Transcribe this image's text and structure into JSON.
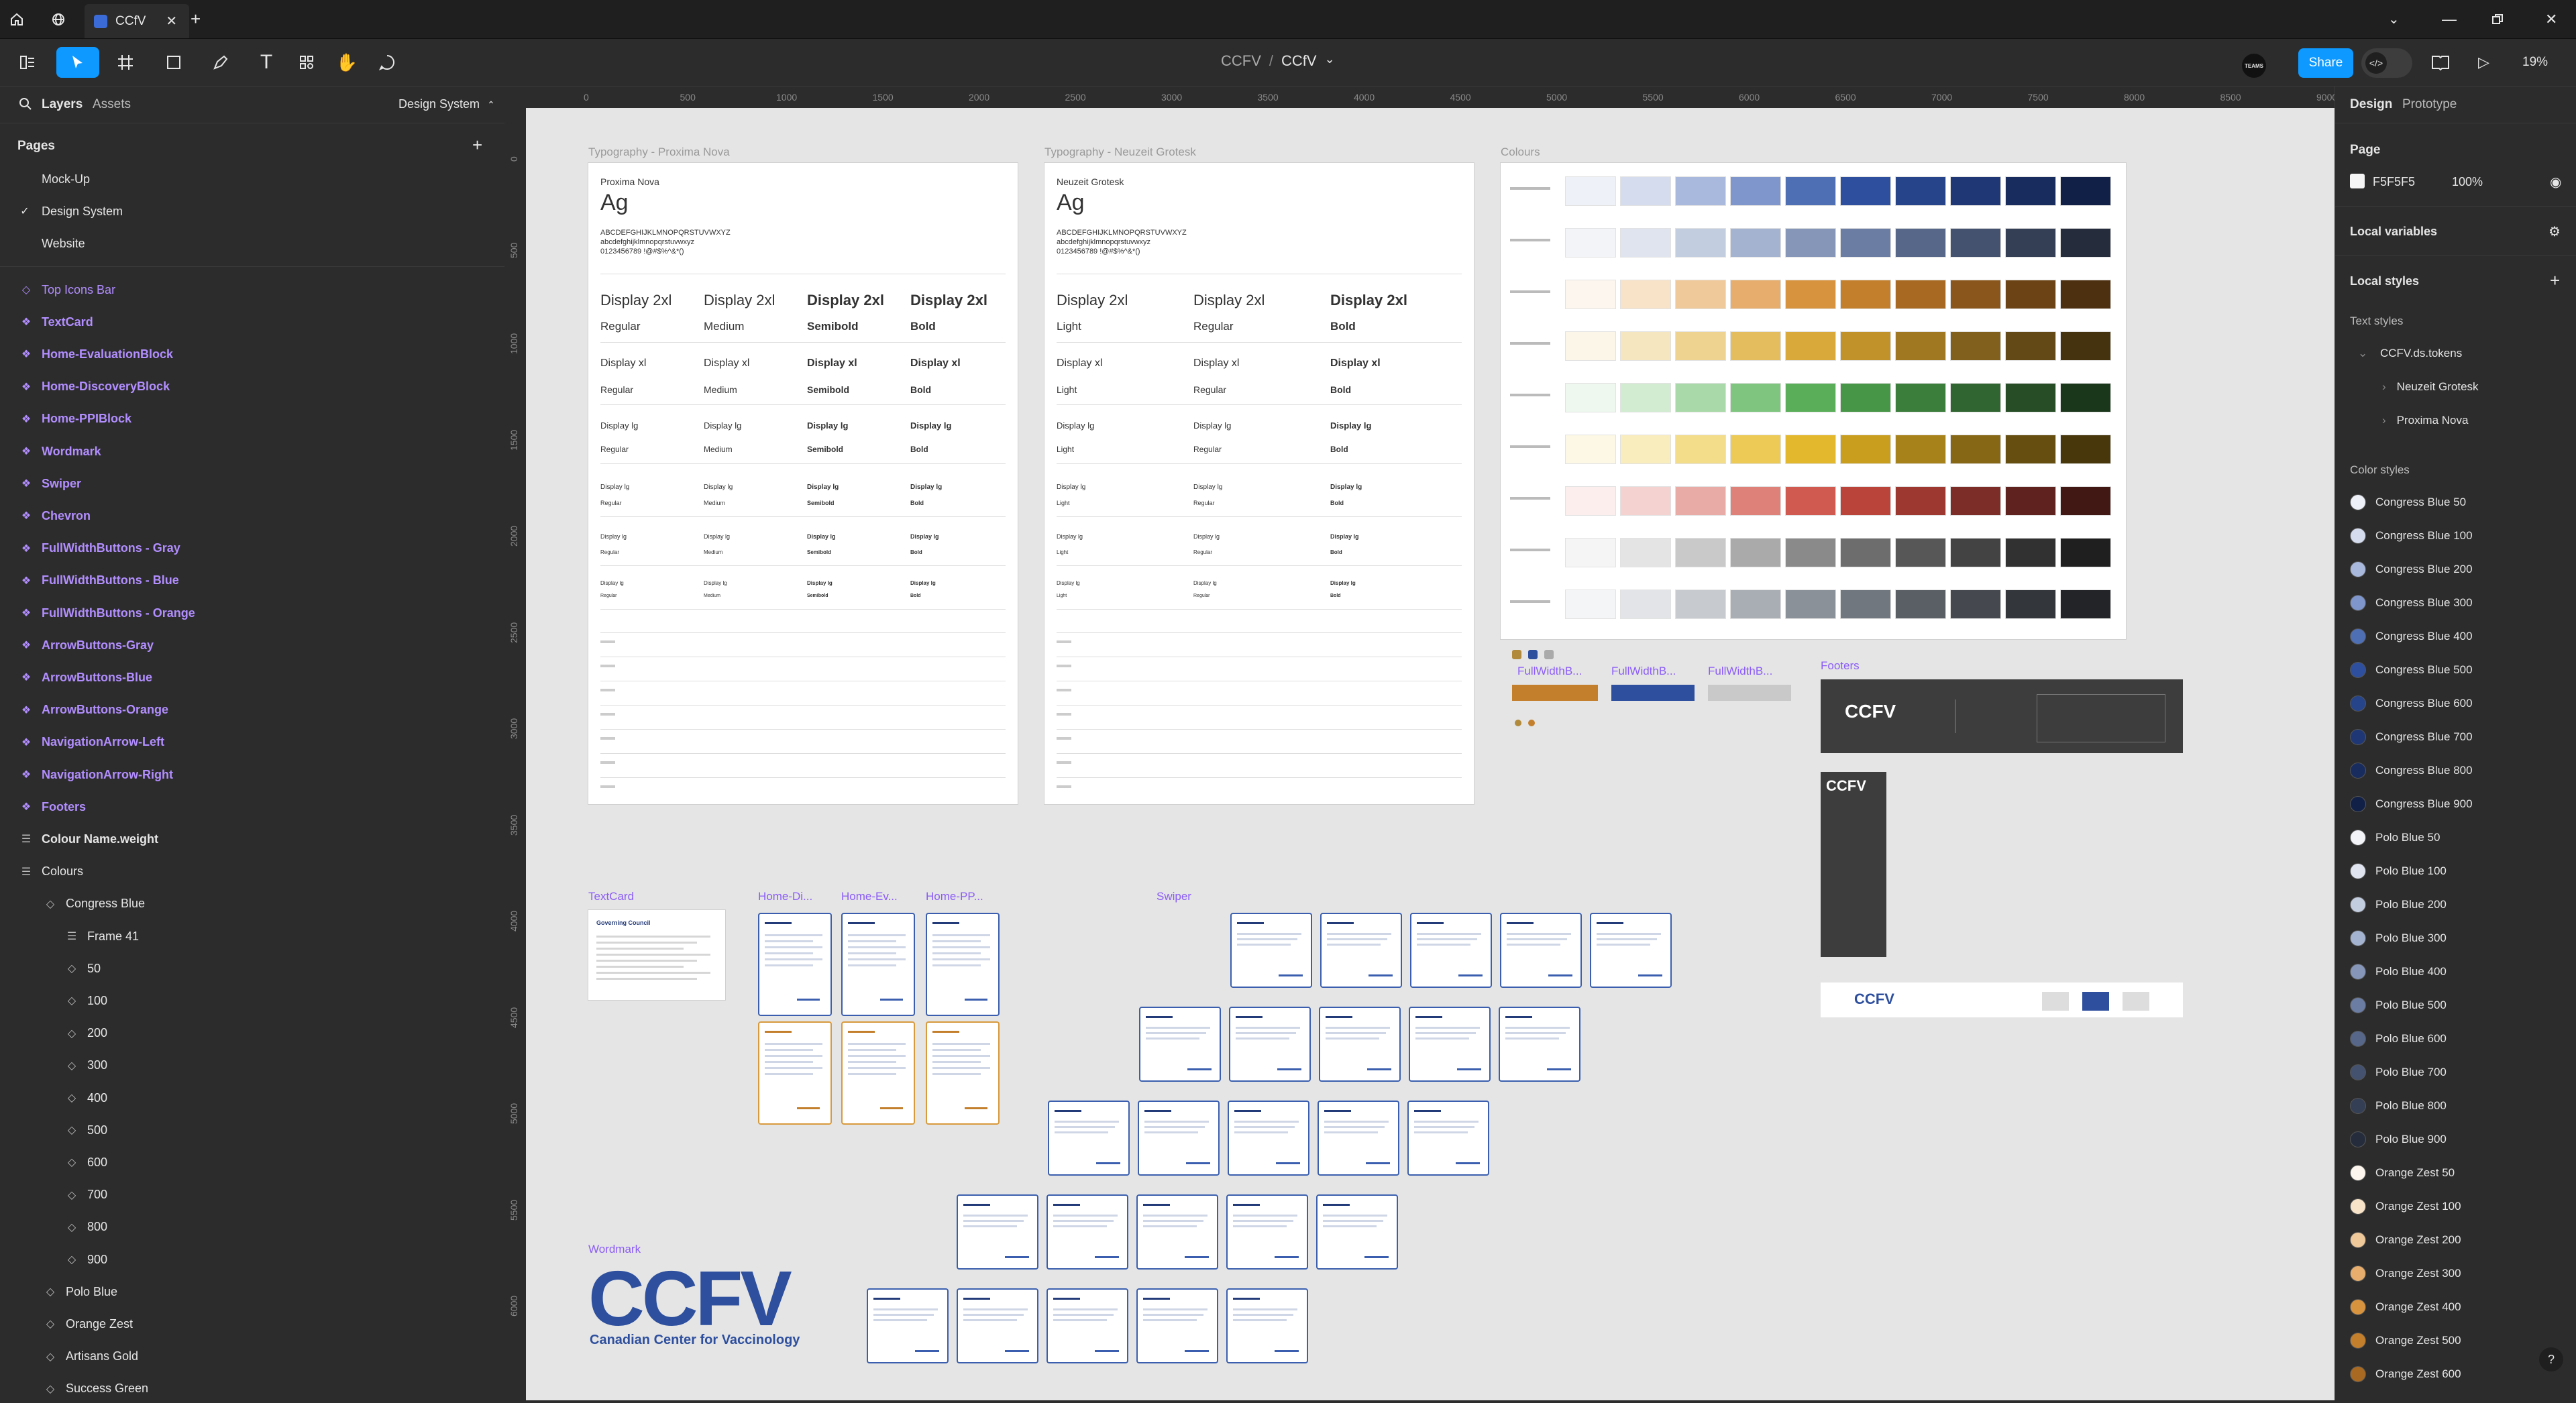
{
  "tabbar": {
    "file_tab_label": "CCfV",
    "new_tab": "+"
  },
  "toolbar": {
    "breadcrumb_project": "CCFV",
    "breadcrumb_sep": "/",
    "breadcrumb_file": "CCfV",
    "teams_badge": "TEAMS",
    "share_label": "Share",
    "zoom_level": "19%"
  },
  "ruler": {
    "top": [
      "0",
      "500",
      "1000",
      "1500",
      "2000",
      "2500",
      "3000",
      "3500",
      "4000",
      "4500",
      "5000",
      "5500",
      "6000",
      "6500",
      "7000",
      "7500",
      "8000",
      "8500",
      "9000"
    ],
    "left": [
      "0",
      "500",
      "1000",
      "1500",
      "2000",
      "2500",
      "3000",
      "3500",
      "4000",
      "4500",
      "5000",
      "5500",
      "6000"
    ]
  },
  "leftpanel": {
    "tab_layers": "Layers",
    "tab_assets": "Assets",
    "page_selector": "Design System",
    "pages_header": "Pages",
    "add_page": "+",
    "pages": [
      "Mock-Up",
      "Design System",
      "Website"
    ],
    "layers": [
      {
        "label": "Top Icons Bar",
        "kind": "frame"
      },
      {
        "label": "TextCard",
        "kind": "comp"
      },
      {
        "label": "Home-EvaluationBlock",
        "kind": "comp"
      },
      {
        "label": "Home-DiscoveryBlock",
        "kind": "comp"
      },
      {
        "label": "Home-PPIBlock",
        "kind": "comp"
      },
      {
        "label": "Wordmark",
        "kind": "comp"
      },
      {
        "label": "Swiper",
        "kind": "comp"
      },
      {
        "label": "Chevron",
        "kind": "comp"
      },
      {
        "label": "FullWidthButtons - Gray",
        "kind": "comp"
      },
      {
        "label": "FullWidthButtons - Blue",
        "kind": "comp"
      },
      {
        "label": "FullWidthButtons - Orange",
        "kind": "comp"
      },
      {
        "label": "ArrowButtons-Gray",
        "kind": "comp"
      },
      {
        "label": "ArrowButtons-Blue",
        "kind": "comp"
      },
      {
        "label": "ArrowButtons-Orange",
        "kind": "comp"
      },
      {
        "label": "NavigationArrow-Left",
        "kind": "comp"
      },
      {
        "label": "NavigationArrow-Right",
        "kind": "comp"
      },
      {
        "label": "Footers",
        "kind": "comp"
      },
      {
        "label": "Colour Name.weight",
        "kind": "plain"
      },
      {
        "label": "Colours",
        "kind": "plain"
      },
      {
        "label": "Congress Blue",
        "kind": "sub"
      },
      {
        "label": "Frame 41",
        "kind": "sub2"
      },
      {
        "label": "50",
        "kind": "sub3"
      },
      {
        "label": "100",
        "kind": "sub3"
      },
      {
        "label": "200",
        "kind": "sub3"
      },
      {
        "label": "300",
        "kind": "sub3"
      },
      {
        "label": "400",
        "kind": "sub3"
      },
      {
        "label": "500",
        "kind": "sub3"
      },
      {
        "label": "600",
        "kind": "sub3"
      },
      {
        "label": "700",
        "kind": "sub3"
      },
      {
        "label": "800",
        "kind": "sub3"
      },
      {
        "label": "900",
        "kind": "sub3"
      },
      {
        "label": "Polo Blue",
        "kind": "sub"
      },
      {
        "label": "Orange Zest",
        "kind": "sub"
      },
      {
        "label": "Artisans Gold",
        "kind": "sub"
      },
      {
        "label": "Success Green",
        "kind": "sub"
      }
    ]
  },
  "rightpanel": {
    "tab_design": "Design",
    "tab_prototype": "Prototype",
    "page_header": "Page",
    "page_color": "F5F5F5",
    "page_opacity": "100%",
    "local_variables": "Local variables",
    "local_styles": "Local styles",
    "text_styles": "Text styles",
    "text_group": "CCFV.ds.tokens",
    "text_items": [
      "Neuzeit Grotesk",
      "Proxima Nova"
    ],
    "color_styles": "Color styles",
    "colors": [
      {
        "name": "Congress Blue 50",
        "hex": "#eef1f8"
      },
      {
        "name": "Congress Blue 100",
        "hex": "#d4dcee"
      },
      {
        "name": "Congress Blue 200",
        "hex": "#a9b9dd"
      },
      {
        "name": "Congress Blue 300",
        "hex": "#7e96cc"
      },
      {
        "name": "Congress Blue 400",
        "hex": "#4f6fb5"
      },
      {
        "name": "Congress Blue 500",
        "hex": "#2d4f9e"
      },
      {
        "name": "Congress Blue 600",
        "hex": "#26448a"
      },
      {
        "name": "Congress Blue 700",
        "hex": "#1f3875"
      },
      {
        "name": "Congress Blue 800",
        "hex": "#182c5e"
      },
      {
        "name": "Congress Blue 900",
        "hex": "#112047"
      },
      {
        "name": "Polo Blue 50",
        "hex": "#f2f4f8"
      },
      {
        "name": "Polo Blue 100",
        "hex": "#dfe4ee"
      },
      {
        "name": "Polo Blue 200",
        "hex": "#c3cde0"
      },
      {
        "name": "Polo Blue 300",
        "hex": "#a4b3cf"
      },
      {
        "name": "Polo Blue 400",
        "hex": "#8596b9"
      },
      {
        "name": "Polo Blue 500",
        "hex": "#6b7da3"
      },
      {
        "name": "Polo Blue 600",
        "hex": "#56678a"
      },
      {
        "name": "Polo Blue 700",
        "hex": "#44526f"
      },
      {
        "name": "Polo Blue 800",
        "hex": "#343f55"
      },
      {
        "name": "Polo Blue 900",
        "hex": "#252d3d"
      },
      {
        "name": "Orange Zest 50",
        "hex": "#fdf6ee"
      },
      {
        "name": "Orange Zest 100",
        "hex": "#f8e3c9"
      },
      {
        "name": "Orange Zest 200",
        "hex": "#f0c99a"
      },
      {
        "name": "Orange Zest 300",
        "hex": "#e6ad6c"
      },
      {
        "name": "Orange Zest 400",
        "hex": "#d8933f"
      },
      {
        "name": "Orange Zest 500",
        "hex": "#c47f2c"
      },
      {
        "name": "Orange Zest 600",
        "hex": "#a86a22"
      }
    ]
  },
  "canvas": {
    "frame_typo_proxima": "Typography - Proxima Nova",
    "frame_typo_neuzeit": "Typography - Neuzeit Grotesk",
    "frame_colours": "Colours",
    "proxima_font": "Proxima Nova",
    "neuzeit_font": "Neuzeit Grotesk",
    "specimen_ag": "Ag",
    "specimen_upper": "ABCDEFGHIJKLMNOPQRSTUVWXYZ",
    "specimen_lower": "abcdefghijklmnopqrstuvwxyz",
    "specimen_digits": "0123456789 !@#$%^&*()",
    "proxima_display2xl": [
      "Display 2xl",
      "Display 2xl",
      "Display 2xl",
      "Display 2xl"
    ],
    "proxima_weights": [
      "Regular",
      "Medium",
      "Semibold",
      "Bold"
    ],
    "proxima_displayxl": [
      "Display xl",
      "Display xl",
      "Display xl",
      "Display xl"
    ],
    "proxima_displaylg": [
      "Display lg",
      "Display lg",
      "Display lg",
      "Display lg"
    ],
    "neuzeit_display2xl": [
      "Display 2xl",
      "Display 2xl",
      "Display 2xl"
    ],
    "neuzeit_weights": [
      "Light",
      "Regular",
      "Bold"
    ],
    "neuzeit_displayxl": [
      "Display xl",
      "Display xl",
      "Display xl"
    ],
    "neuzeit_displaylg": [
      "Display lg",
      "Display lg",
      "Display lg"
    ],
    "comp_textcard": "TextCard",
    "comp_home_di": "Home-Di...",
    "comp_home_ev": "Home-Ev...",
    "comp_home_pp": "Home-PP...",
    "comp_swiper": "Swiper",
    "comp_wordmark": "Wordmark",
    "comp_footers": "Footers",
    "comp_fullwidth1": "FullWidthB...",
    "comp_fullwidth2": "FullWidthB...",
    "comp_fullwidth3": "FullWidthB...",
    "textcard_title": "Governing Council",
    "wordmark_letters": "CCFV",
    "wordmark_sub": "Canadian Center for Vaccinology",
    "footer_logo": "CCFV",
    "swatch_rows": [
      [
        "#eef1f8",
        "#d4dcee",
        "#a9b9dd",
        "#7e96cc",
        "#4f6fb5",
        "#2d4f9e",
        "#26448a",
        "#1f3875",
        "#182c5e",
        "#112047"
      ],
      [
        "#f2f4f8",
        "#dfe4ee",
        "#c3cde0",
        "#a4b3cf",
        "#8596b9",
        "#6b7da3",
        "#56678a",
        "#44526f",
        "#343f55",
        "#252d3d"
      ],
      [
        "#fdf6ee",
        "#f8e3c9",
        "#f0c99a",
        "#e6ad6c",
        "#d8933f",
        "#c47f2c",
        "#a86a22",
        "#8a561b",
        "#6b4315",
        "#4d300f"
      ],
      [
        "#fcf6e8",
        "#f6e6bf",
        "#eed28f",
        "#e4bd5f",
        "#d9a93a",
        "#c2922a",
        "#a17822",
        "#80601c",
        "#624916",
        "#453310"
      ],
      [
        "#eef8ee",
        "#d2ecd2",
        "#a9d9a9",
        "#7fc57f",
        "#5aae5a",
        "#479647",
        "#3b7d3b",
        "#306430",
        "#264d26",
        "#1b371b"
      ],
      [
        "#fdf8e6",
        "#f9ecbd",
        "#f3dc8a",
        "#ecca55",
        "#e3b82c",
        "#c99e1f",
        "#a7821a",
        "#856715",
        "#654e10",
        "#47370b"
      ],
      [
        "#fbeeed",
        "#f3d2cf",
        "#e9aba5",
        "#dd8179",
        "#d05a4f",
        "#bb443a",
        "#9c3830",
        "#7d2d27",
        "#5f221e",
        "#421815"
      ],
      [
        "#f5f5f5",
        "#e4e4e4",
        "#c9c9c9",
        "#aaaaaa",
        "#8a8a8a",
        "#6d6d6d",
        "#575757",
        "#434343",
        "#313131",
        "#1f1f1f"
      ],
      [
        "#f4f5f6",
        "#e2e4e7",
        "#c7cbd0",
        "#a9aeb5",
        "#8b9199",
        "#71777f",
        "#5a5f66",
        "#45494f",
        "#33363a",
        "#222427"
      ]
    ]
  }
}
